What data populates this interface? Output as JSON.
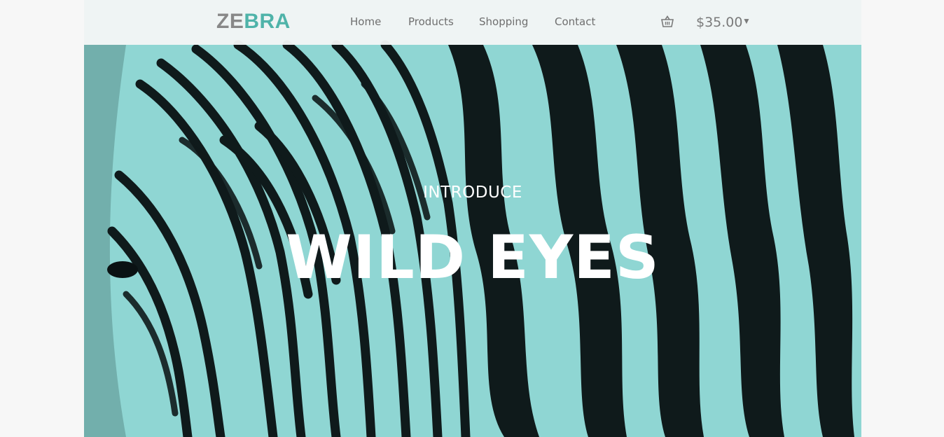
{
  "brand": {
    "logo_part1": "ZE",
    "logo_part2": "BRA",
    "logo_gray": "#888888",
    "logo_teal": "#4fb3a9"
  },
  "nav": {
    "items": [
      {
        "label": "Home"
      },
      {
        "label": "Products"
      },
      {
        "label": "Shopping"
      },
      {
        "label": "Contact"
      }
    ]
  },
  "cart": {
    "icon": "basket-icon",
    "total": "$35.00",
    "dropdown_icon": "caret-down-icon"
  },
  "hero": {
    "image": "zebra-stripes-photo",
    "tint": "#8ed6d2",
    "stripe_color": "#0f1a1b",
    "overline": "INTRODUCE",
    "headline": "WILD EYES"
  }
}
